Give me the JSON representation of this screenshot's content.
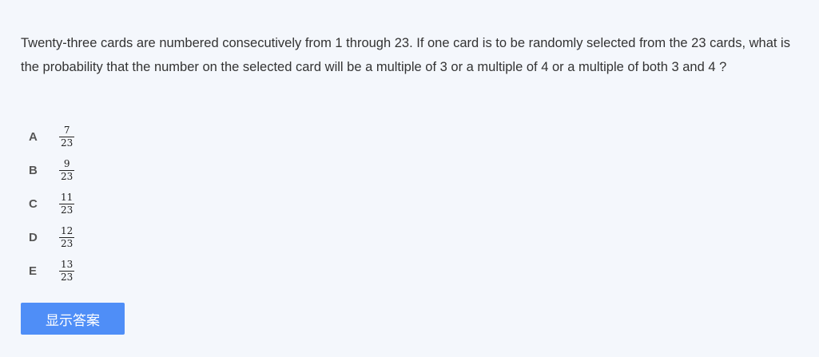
{
  "question": {
    "text": "Twenty-three cards are numbered consecutively from 1 through 23. If one card is to be randomly selected from the 23 cards, what is the probability that the number on the selected card will be a multiple of 3 or a multiple of 4 or a multiple of both 3 and 4 ?"
  },
  "options": [
    {
      "letter": "A",
      "numerator": "7",
      "denominator": "23"
    },
    {
      "letter": "B",
      "numerator": "9",
      "denominator": "23"
    },
    {
      "letter": "C",
      "numerator": "11",
      "denominator": "23"
    },
    {
      "letter": "D",
      "numerator": "12",
      "denominator": "23"
    },
    {
      "letter": "E",
      "numerator": "13",
      "denominator": "23"
    }
  ],
  "show_answer_button": {
    "label": "显示答案",
    "color": "#4f8ef7"
  }
}
